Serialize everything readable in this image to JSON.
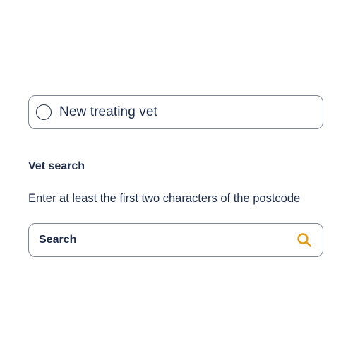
{
  "treating_vet": {
    "option_label": "New treating vet",
    "selected": false
  },
  "vet_search": {
    "heading": "Vet search",
    "hint": "Enter at least the first two characters of the postcode",
    "search_placeholder": "Search",
    "search_value": "",
    "search_icon": "magnifier-icon"
  },
  "colors": {
    "text": "#1c2b4a",
    "border": "#7d8493",
    "accent": "#e39a12"
  }
}
